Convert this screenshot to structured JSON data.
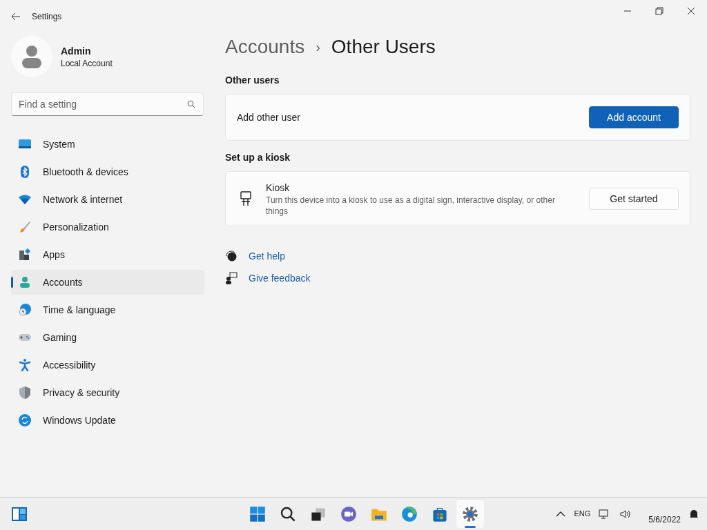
{
  "window": {
    "title": "Settings"
  },
  "profile": {
    "name": "Admin",
    "account_type": "Local Account"
  },
  "search": {
    "placeholder": "Find a setting"
  },
  "sidebar": {
    "items": [
      {
        "label": "System",
        "selected": false
      },
      {
        "label": "Bluetooth & devices",
        "selected": false
      },
      {
        "label": "Network & internet",
        "selected": false
      },
      {
        "label": "Personalization",
        "selected": false
      },
      {
        "label": "Apps",
        "selected": false
      },
      {
        "label": "Accounts",
        "selected": true
      },
      {
        "label": "Time & language",
        "selected": false
      },
      {
        "label": "Gaming",
        "selected": false
      },
      {
        "label": "Accessibility",
        "selected": false
      },
      {
        "label": "Privacy & security",
        "selected": false
      },
      {
        "label": "Windows Update",
        "selected": false
      }
    ]
  },
  "breadcrumb": {
    "parent": "Accounts",
    "separator": "›",
    "current": "Other Users"
  },
  "sections": [
    {
      "heading": "Other users",
      "card": {
        "title": "Add other user",
        "button": "Add account",
        "primary": true
      }
    },
    {
      "heading": "Set up a kiosk",
      "card": {
        "title": "Kiosk",
        "description": "Turn this device into a kiosk to use as a digital sign, interactive display, or other things",
        "button": "Get started",
        "primary": false
      }
    }
  ],
  "links": [
    "Get help",
    "Give feedback"
  ],
  "taskbar": {
    "apps": [
      {
        "selected": false
      },
      {
        "selected": false
      },
      {
        "selected": false
      },
      {
        "selected": false
      },
      {
        "selected": false
      },
      {
        "selected": false
      },
      {
        "selected": false
      },
      {
        "selected": true
      }
    ],
    "language": "ENG",
    "date": "5/6/2022"
  }
}
